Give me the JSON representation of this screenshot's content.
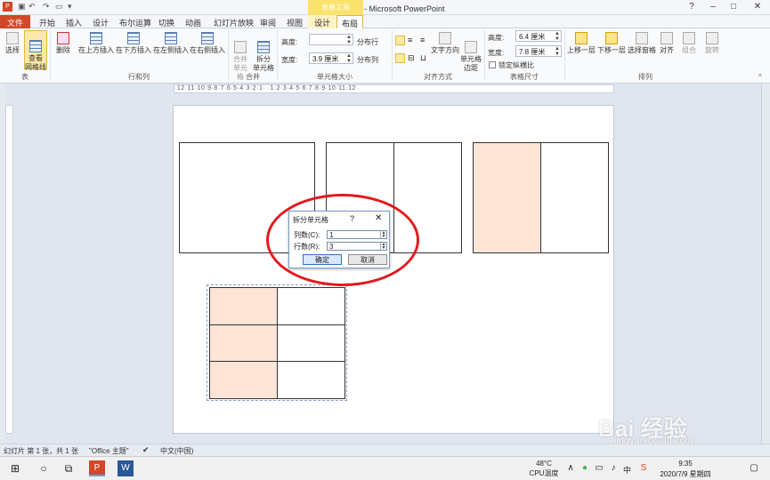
{
  "window": {
    "title": "演示文稿1 - Microsoft PowerPoint",
    "context_tab_group": "表格工具",
    "caption_buttons": [
      "?",
      "–",
      "□",
      "✕"
    ]
  },
  "tabs": [
    "文件",
    "开始",
    "插入",
    "设计",
    "布尔运算",
    "切换",
    "动画",
    "幻灯片放映",
    "审阅",
    "视图",
    "设计",
    "布局"
  ],
  "ribbon": {
    "groups": [
      "表",
      "行和列",
      "合并",
      "单元格大小",
      "对齐方式",
      "表格尺寸",
      "排列"
    ],
    "table_group": [
      "选择",
      "查看\n网格线"
    ],
    "rows_cols": [
      "删除",
      "在上方插入",
      "在下方插入",
      "在左侧插入",
      "在右侧插入"
    ],
    "merge": [
      "合并\n单元格",
      "拆分\n单元格"
    ],
    "cell_size": {
      "height_label": "高度:",
      "height_value": "",
      "width_label": "宽度:",
      "width_value": "3.9 厘米",
      "distribute_rows": "分布行",
      "distribute_cols": "分布列"
    },
    "alignment": [
      "文字方向",
      "单元格\n边距"
    ],
    "table_size": {
      "height_label": "高度:",
      "height_value": "6.4 厘米",
      "width_label": "宽度:",
      "width_value": "7.8 厘米",
      "lock_ratio": "锁定纵横比"
    },
    "arrange": [
      "上移一层",
      "下移一层",
      "选择窗格",
      "对齐",
      "组合",
      "旋转"
    ]
  },
  "ruler_text": "·12·11·10·9·8·7·6·5·4·3·2·1· ·1·2·3·4·5·6·7·8·9·10·11·12·",
  "dialog": {
    "title": "拆分单元格",
    "help": "?",
    "close": "✕",
    "cols_label": "列数(C):",
    "cols_value": "1",
    "rows_label": "行数(R):",
    "rows_value": "3",
    "ok": "确定",
    "cancel": "取消"
  },
  "status": {
    "slide_info": "幻灯片 第 1 张，共 1 张",
    "theme": "\"Office 主题\"",
    "language": "中文(中国)"
  },
  "taskbar": {
    "temp": "48°C",
    "cpu": "CPU温度",
    "ime": "中",
    "time": "9:35",
    "date": "2020/7/9 星期四"
  },
  "watermark": {
    "logo": "Bai 经验",
    "url": "jingyan.baidu.com"
  },
  "colors": {
    "file_tab": "#d24726",
    "context_tab": "#fbe26a",
    "cell_fill": "#fce4d6",
    "ellipse": "#e3191f"
  }
}
